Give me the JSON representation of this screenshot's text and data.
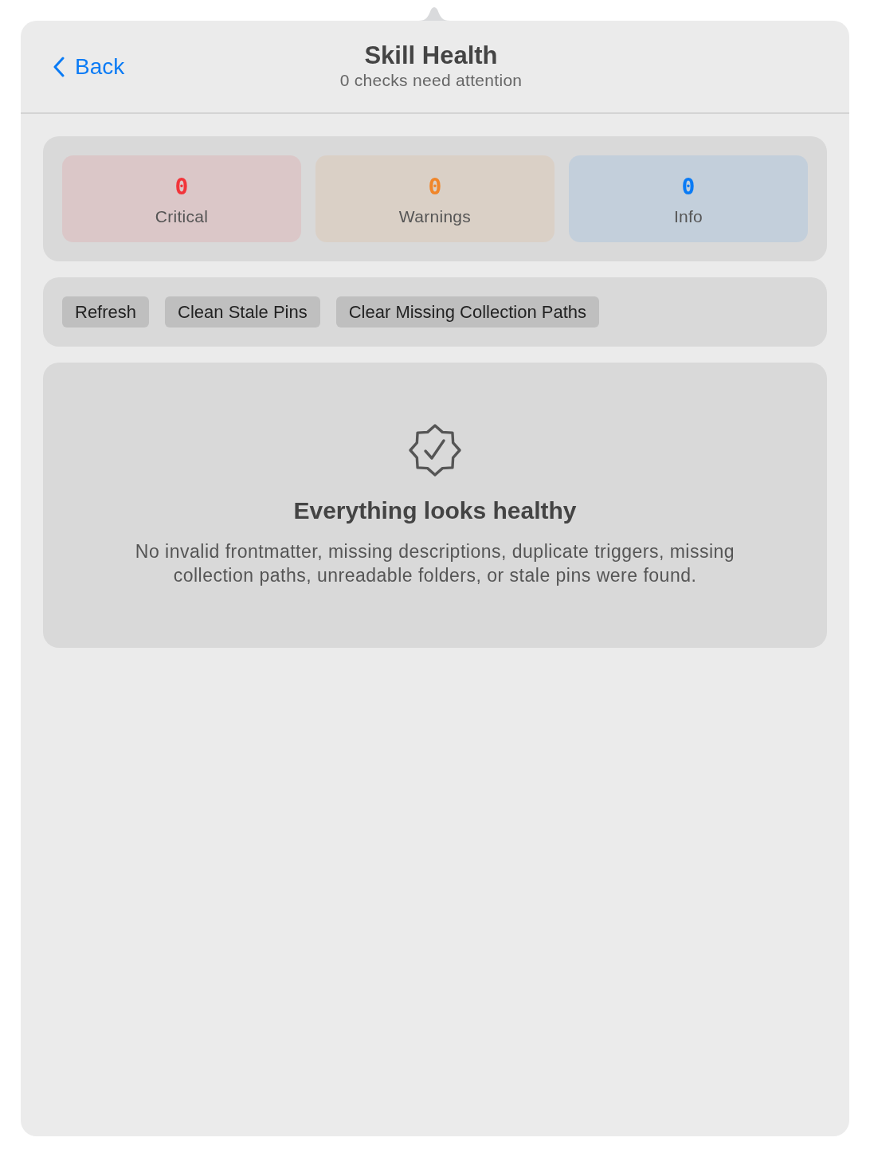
{
  "header": {
    "back": "Back",
    "title": "Skill Health",
    "subtitle": "0 checks need attention"
  },
  "summary": [
    {
      "count": "0",
      "label": "Critical",
      "color": "#f2343a"
    },
    {
      "count": "0",
      "label": "Warnings",
      "color": "#f0862a"
    },
    {
      "count": "0",
      "label": "Info",
      "color": "#0a7bf5"
    }
  ],
  "actions": [
    "Refresh",
    "Clean Stale Pins",
    "Clear Missing Collection Paths"
  ],
  "empty_state": {
    "title": "Everything looks healthy",
    "message": "No invalid frontmatter, missing descriptions, duplicate triggers, missing collection paths, unreadable folders, or stale pins were found."
  }
}
